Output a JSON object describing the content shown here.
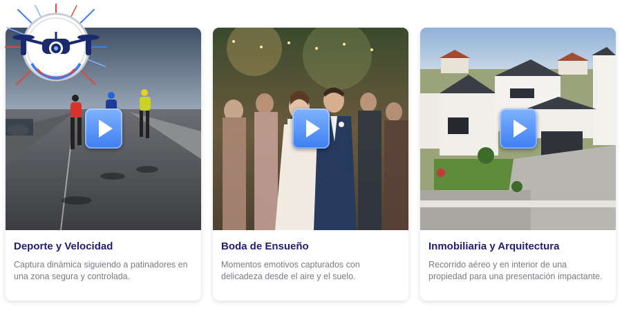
{
  "logo": {
    "icon": "drone-icon"
  },
  "cards": [
    {
      "title": "Deporte y Velocidad",
      "description": "Captura dinámica siguiendo a patinadores en una zona segura y controlada.",
      "image": "inline-skaters-road-image",
      "play_icon": "play-icon"
    },
    {
      "title": "Boda de Ensueño",
      "description": "Momentos emotivos capturados con delicadeza desde el aire y el suelo.",
      "image": "wedding-couple-image",
      "play_icon": "play-icon"
    },
    {
      "title": "Inmobiliaria y Arquitectura",
      "description": "Recorrido aéreo y en interior de una propiedad para una presentación impactante.",
      "image": "modern-house-aerial-image",
      "play_icon": "play-icon"
    }
  ],
  "colors": {
    "title": "#1c1f6e",
    "description": "#7a7a84",
    "play_button": "#4a8af4"
  }
}
